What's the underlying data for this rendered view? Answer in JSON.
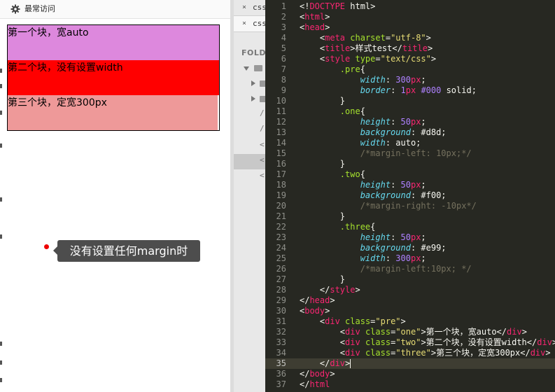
{
  "browser": {
    "bookmarks_bar": {
      "label": "最常访问",
      "icon": "gear-icon"
    },
    "blocks": [
      {
        "text": "第一个块，宽auto",
        "color": "#dd88dd"
      },
      {
        "text": "第二个块，没有设置width",
        "color": "#ff0000"
      },
      {
        "text": "第三个块，定宽300px",
        "color": "#ee9999"
      }
    ],
    "tooltip": {
      "text": "没有设置任何margin时"
    }
  },
  "sidebar": {
    "tabs": [
      {
        "label": "css",
        "close": "×"
      },
      {
        "label": "css",
        "close": "×"
      }
    ],
    "folders_label": "FOLD",
    "tree_glyphs": [
      "/",
      "/",
      "<",
      "<",
      "<"
    ]
  },
  "editor": {
    "current_line": 35,
    "lines": [
      {
        "n": 1,
        "tokens": [
          {
            "t": "<!",
            "c": "w"
          },
          {
            "t": "DOCTYPE",
            "c": "t"
          },
          {
            "t": " html>",
            "c": "w"
          }
        ]
      },
      {
        "n": 2,
        "tokens": [
          {
            "t": "<",
            "c": "w"
          },
          {
            "t": "html",
            "c": "t"
          },
          {
            "t": ">",
            "c": "w"
          }
        ]
      },
      {
        "n": 3,
        "tokens": [
          {
            "t": "<",
            "c": "w"
          },
          {
            "t": "head",
            "c": "t"
          },
          {
            "t": ">",
            "c": "w"
          }
        ]
      },
      {
        "n": 4,
        "tokens": [
          {
            "t": "    <",
            "c": "w"
          },
          {
            "t": "meta",
            "c": "t"
          },
          {
            "t": " ",
            "c": "w"
          },
          {
            "t": "charset",
            "c": "a"
          },
          {
            "t": "=",
            "c": "w"
          },
          {
            "t": "\"utf-8\"",
            "c": "s"
          },
          {
            "t": ">",
            "c": "w"
          }
        ]
      },
      {
        "n": 5,
        "tokens": [
          {
            "t": "    <",
            "c": "w"
          },
          {
            "t": "title",
            "c": "t"
          },
          {
            "t": ">样式test</",
            "c": "w"
          },
          {
            "t": "title",
            "c": "t"
          },
          {
            "t": ">",
            "c": "w"
          }
        ]
      },
      {
        "n": 6,
        "tokens": [
          {
            "t": "    <",
            "c": "w"
          },
          {
            "t": "style",
            "c": "t"
          },
          {
            "t": " ",
            "c": "w"
          },
          {
            "t": "type",
            "c": "a"
          },
          {
            "t": "=",
            "c": "w"
          },
          {
            "t": "\"text/css\"",
            "c": "s"
          },
          {
            "t": ">",
            "c": "w"
          }
        ]
      },
      {
        "n": 7,
        "tokens": [
          {
            "t": "        ",
            "c": "w"
          },
          {
            "t": ".pre",
            "c": "a"
          },
          {
            "t": "{",
            "c": "w"
          }
        ]
      },
      {
        "n": 8,
        "tokens": [
          {
            "t": "            ",
            "c": "w"
          },
          {
            "t": "width",
            "c": "p"
          },
          {
            "t": ": ",
            "c": "w"
          },
          {
            "t": "300",
            "c": "n"
          },
          {
            "t": "px",
            "c": "t"
          },
          {
            "t": ";",
            "c": "w"
          }
        ]
      },
      {
        "n": 9,
        "tokens": [
          {
            "t": "            ",
            "c": "w"
          },
          {
            "t": "border",
            "c": "p"
          },
          {
            "t": ": ",
            "c": "w"
          },
          {
            "t": "1",
            "c": "n"
          },
          {
            "t": "px",
            "c": "t"
          },
          {
            "t": " ",
            "c": "w"
          },
          {
            "t": "#000",
            "c": "n"
          },
          {
            "t": " solid;",
            "c": "w"
          }
        ]
      },
      {
        "n": 10,
        "tokens": [
          {
            "t": "        }",
            "c": "w"
          }
        ]
      },
      {
        "n": 11,
        "tokens": [
          {
            "t": "        ",
            "c": "w"
          },
          {
            "t": ".one",
            "c": "a"
          },
          {
            "t": "{",
            "c": "w"
          }
        ]
      },
      {
        "n": 12,
        "tokens": [
          {
            "t": "            ",
            "c": "w"
          },
          {
            "t": "height",
            "c": "p"
          },
          {
            "t": ": ",
            "c": "w"
          },
          {
            "t": "50",
            "c": "n"
          },
          {
            "t": "px",
            "c": "t"
          },
          {
            "t": ";",
            "c": "w"
          }
        ]
      },
      {
        "n": 13,
        "tokens": [
          {
            "t": "            ",
            "c": "w"
          },
          {
            "t": "background",
            "c": "p"
          },
          {
            "t": ": #d8d;",
            "c": "w"
          }
        ]
      },
      {
        "n": 14,
        "tokens": [
          {
            "t": "            ",
            "c": "w"
          },
          {
            "t": "width",
            "c": "p"
          },
          {
            "t": ": auto;",
            "c": "w"
          }
        ]
      },
      {
        "n": 15,
        "tokens": [
          {
            "t": "            ",
            "c": "w"
          },
          {
            "t": "/*margin-left: 10px;*/",
            "c": "c"
          }
        ]
      },
      {
        "n": 16,
        "tokens": [
          {
            "t": "        }",
            "c": "w"
          }
        ]
      },
      {
        "n": 17,
        "tokens": [
          {
            "t": "        ",
            "c": "w"
          },
          {
            "t": ".two",
            "c": "a"
          },
          {
            "t": "{",
            "c": "w"
          }
        ]
      },
      {
        "n": 18,
        "tokens": [
          {
            "t": "            ",
            "c": "w"
          },
          {
            "t": "height",
            "c": "p"
          },
          {
            "t": ": ",
            "c": "w"
          },
          {
            "t": "50",
            "c": "n"
          },
          {
            "t": "px",
            "c": "t"
          },
          {
            "t": ";",
            "c": "w"
          }
        ]
      },
      {
        "n": 19,
        "tokens": [
          {
            "t": "            ",
            "c": "w"
          },
          {
            "t": "background",
            "c": "p"
          },
          {
            "t": ": #f00;",
            "c": "w"
          }
        ]
      },
      {
        "n": 20,
        "tokens": [
          {
            "t": "            ",
            "c": "w"
          },
          {
            "t": "/*margin-right: -10px*/",
            "c": "c"
          }
        ]
      },
      {
        "n": 21,
        "tokens": [
          {
            "t": "        }",
            "c": "w"
          }
        ]
      },
      {
        "n": 22,
        "tokens": [
          {
            "t": "        ",
            "c": "w"
          },
          {
            "t": ".three",
            "c": "a"
          },
          {
            "t": "{",
            "c": "w"
          }
        ]
      },
      {
        "n": 23,
        "tokens": [
          {
            "t": "            ",
            "c": "w"
          },
          {
            "t": "height",
            "c": "p"
          },
          {
            "t": ": ",
            "c": "w"
          },
          {
            "t": "50",
            "c": "n"
          },
          {
            "t": "px",
            "c": "t"
          },
          {
            "t": ";",
            "c": "w"
          }
        ]
      },
      {
        "n": 24,
        "tokens": [
          {
            "t": "            ",
            "c": "w"
          },
          {
            "t": "background",
            "c": "p"
          },
          {
            "t": ": #e99;",
            "c": "w"
          }
        ]
      },
      {
        "n": 25,
        "tokens": [
          {
            "t": "            ",
            "c": "w"
          },
          {
            "t": "width",
            "c": "p"
          },
          {
            "t": ": ",
            "c": "w"
          },
          {
            "t": "300",
            "c": "n"
          },
          {
            "t": "px",
            "c": "t"
          },
          {
            "t": ";",
            "c": "w"
          }
        ]
      },
      {
        "n": 26,
        "tokens": [
          {
            "t": "            ",
            "c": "w"
          },
          {
            "t": "/*margin-left:10px; */",
            "c": "c"
          }
        ]
      },
      {
        "n": 27,
        "tokens": [
          {
            "t": "        }",
            "c": "w"
          }
        ]
      },
      {
        "n": 28,
        "tokens": [
          {
            "t": "    </",
            "c": "w"
          },
          {
            "t": "style",
            "c": "t"
          },
          {
            "t": ">",
            "c": "w"
          }
        ]
      },
      {
        "n": 29,
        "tokens": [
          {
            "t": "</",
            "c": "w"
          },
          {
            "t": "head",
            "c": "t"
          },
          {
            "t": ">",
            "c": "w"
          }
        ]
      },
      {
        "n": 30,
        "tokens": [
          {
            "t": "<",
            "c": "w"
          },
          {
            "t": "body",
            "c": "t"
          },
          {
            "t": ">",
            "c": "w"
          }
        ]
      },
      {
        "n": 31,
        "tokens": [
          {
            "t": "    <",
            "c": "w"
          },
          {
            "t": "div",
            "c": "t"
          },
          {
            "t": " ",
            "c": "w"
          },
          {
            "t": "class",
            "c": "a"
          },
          {
            "t": "=",
            "c": "w"
          },
          {
            "t": "\"pre\"",
            "c": "s"
          },
          {
            "t": ">",
            "c": "w"
          }
        ]
      },
      {
        "n": 32,
        "tokens": [
          {
            "t": "        <",
            "c": "w"
          },
          {
            "t": "div",
            "c": "t"
          },
          {
            "t": " ",
            "c": "w"
          },
          {
            "t": "class",
            "c": "a"
          },
          {
            "t": "=",
            "c": "w"
          },
          {
            "t": "\"one\"",
            "c": "s"
          },
          {
            "t": ">第一个块，宽auto</",
            "c": "w"
          },
          {
            "t": "div",
            "c": "t"
          },
          {
            "t": ">",
            "c": "w"
          }
        ]
      },
      {
        "n": 33,
        "tokens": [
          {
            "t": "        <",
            "c": "w"
          },
          {
            "t": "div",
            "c": "t"
          },
          {
            "t": " ",
            "c": "w"
          },
          {
            "t": "class",
            "c": "a"
          },
          {
            "t": "=",
            "c": "w"
          },
          {
            "t": "\"two\"",
            "c": "s"
          },
          {
            "t": ">第二个块，没有设置width</",
            "c": "w"
          },
          {
            "t": "div",
            "c": "t"
          },
          {
            "t": ">",
            "c": "w"
          }
        ]
      },
      {
        "n": 34,
        "tokens": [
          {
            "t": "        <",
            "c": "w"
          },
          {
            "t": "div",
            "c": "t"
          },
          {
            "t": " ",
            "c": "w"
          },
          {
            "t": "class",
            "c": "a"
          },
          {
            "t": "=",
            "c": "w"
          },
          {
            "t": "\"three\"",
            "c": "s"
          },
          {
            "t": ">第三个块，定宽300px</",
            "c": "w"
          },
          {
            "t": "div",
            "c": "t"
          },
          {
            "t": ">",
            "c": "w"
          }
        ]
      },
      {
        "n": 35,
        "tokens": [
          {
            "t": "    </",
            "c": "w"
          },
          {
            "t": "div",
            "c": "t"
          },
          {
            "t": ">",
            "c": "w"
          }
        ]
      },
      {
        "n": 36,
        "tokens": [
          {
            "t": "</",
            "c": "w"
          },
          {
            "t": "body",
            "c": "t"
          },
          {
            "t": ">",
            "c": "w"
          }
        ]
      },
      {
        "n": 37,
        "tokens": [
          {
            "t": "</",
            "c": "w"
          },
          {
            "t": "html",
            "c": "t"
          }
        ]
      }
    ]
  }
}
